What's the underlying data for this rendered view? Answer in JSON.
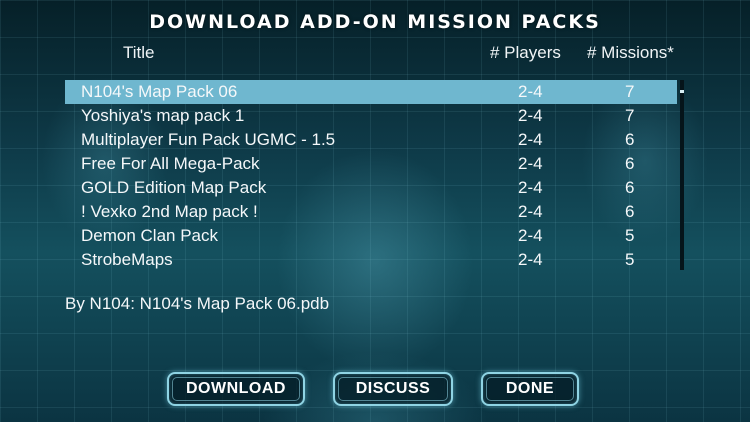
{
  "header": {
    "title": "DOWNLOAD ADD-ON MISSION PACKS"
  },
  "columns": {
    "title": "Title",
    "players": "# Players",
    "missions": "# Missions*"
  },
  "packs": [
    {
      "title": "N104's Map Pack 06",
      "players": "2-4",
      "missions": "7",
      "selected": true
    },
    {
      "title": "Yoshiya's map pack 1",
      "players": "2-4",
      "missions": "7",
      "selected": false
    },
    {
      "title": "Multiplayer Fun Pack UGMC - 1.5",
      "players": "2-4",
      "missions": "6",
      "selected": false
    },
    {
      "title": "Free For All Mega-Pack",
      "players": "2-4",
      "missions": "6",
      "selected": false
    },
    {
      "title": "GOLD Edition Map Pack",
      "players": "2-4",
      "missions": "6",
      "selected": false
    },
    {
      "title": "! Vexko 2nd Map pack !",
      "players": "2-4",
      "missions": "6",
      "selected": false
    },
    {
      "title": "Demon Clan Pack",
      "players": "2-4",
      "missions": "5",
      "selected": false
    },
    {
      "title": "StrobeMaps",
      "players": "2-4",
      "missions": "5",
      "selected": false
    }
  ],
  "selected_info": "By N104: N104's Map Pack 06.pdb",
  "buttons": {
    "download": "DOWNLOAD",
    "discuss": "DISCUSS",
    "done": "DONE"
  },
  "colors": {
    "selection_highlight": "#6fb7cf",
    "button_border": "#8fd4e4",
    "background": "#0e3a48"
  }
}
